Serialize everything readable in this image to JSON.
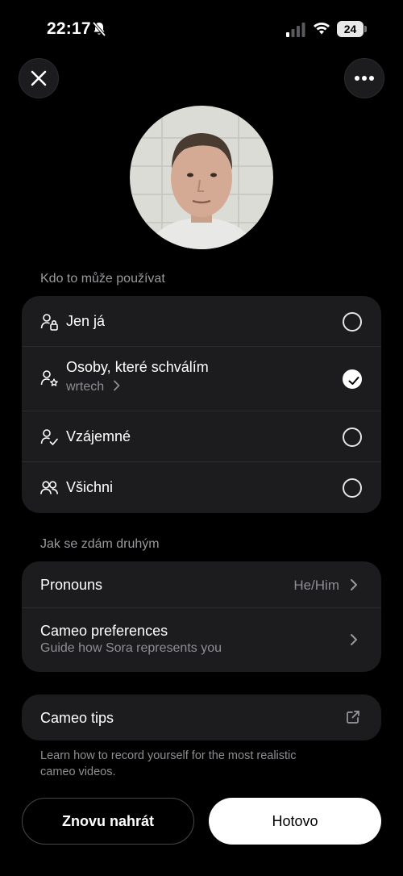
{
  "status_bar": {
    "time": "22:17",
    "battery": "24"
  },
  "header": {
    "close_icon": "close-icon",
    "more_icon": "more-horizontal-icon"
  },
  "usage": {
    "title": "Kdo to může používat",
    "options": [
      {
        "label": "Jen já",
        "icon": "person-lock-icon",
        "selected": false
      },
      {
        "label": "Osoby, které schválím",
        "sub": "wrtech",
        "icon": "person-star-icon",
        "selected": true
      },
      {
        "label": "Vzájemné",
        "icon": "person-check-icon",
        "selected": false
      },
      {
        "label": "Všichni",
        "icon": "people-icon",
        "selected": false
      }
    ]
  },
  "appearance": {
    "title": "Jak se zdám druhým",
    "pronouns_label": "Pronouns",
    "pronouns_value": "He/Him",
    "cameo_prefs_label": "Cameo preferences",
    "cameo_prefs_sub": "Guide how Sora represents you"
  },
  "tips": {
    "label": "Cameo tips",
    "footnote": "Learn how to record yourself for the most realistic cameo videos."
  },
  "actions": {
    "rerecord": "Znovu nahrát",
    "done": "Hotovo"
  },
  "colors": {
    "background": "#000000",
    "card": "#1c1c1e",
    "muted_text": "#8e8e93"
  }
}
